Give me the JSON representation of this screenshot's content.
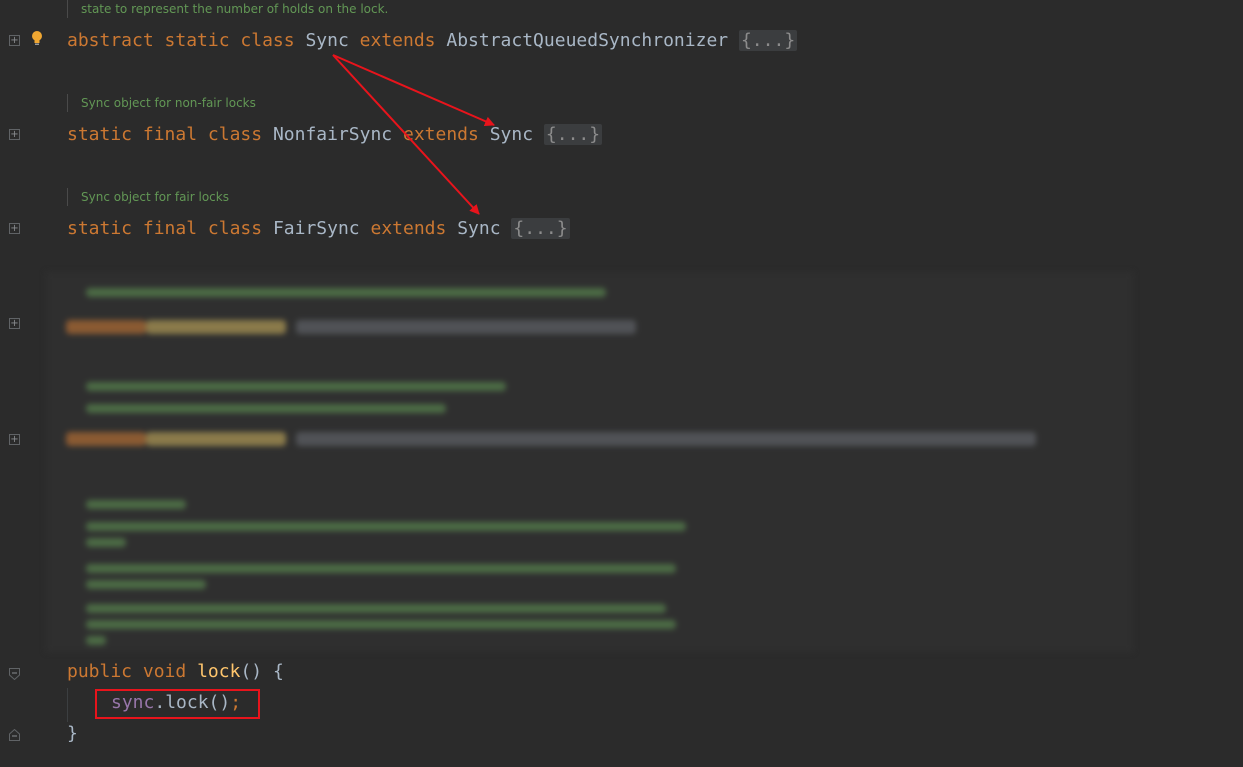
{
  "top_doc": "state to represent the number of holds on the lock.",
  "sync_decl": {
    "kw1": "abstract",
    "kw2": "static",
    "kw3": "class",
    "name": "Sync",
    "extends": "extends",
    "super": "AbstractQueuedSynchronizer",
    "folded": "{...}"
  },
  "nonfair_doc": "Sync object for non-fair locks",
  "nonfair_decl": {
    "kw1": "static",
    "kw2": "final",
    "kw3": "class",
    "name": "NonfairSync",
    "extends": "extends",
    "super": "Sync",
    "folded": "{...}"
  },
  "fair_doc": "Sync object for fair locks",
  "fair_decl": {
    "kw1": "static",
    "kw2": "final",
    "kw3": "class",
    "name": "FairSync",
    "extends": "extends",
    "super": "Sync",
    "folded": "{...}"
  },
  "lock_method": {
    "kw1": "public",
    "kw2": "void",
    "name": "lock",
    "sig_rest": "() {",
    "body_field": "sync",
    "body_call": ".lock()",
    "body_end": ";",
    "close": "}"
  },
  "colors": {
    "background": "#2b2b2b",
    "keyword": "#cc7832",
    "comment": "#629755",
    "method": "#ffc66d",
    "field": "#9876aa",
    "annotation_red": "#e8141c"
  },
  "icons": [
    "fold-plus-icon",
    "fold-minus-icon",
    "intention-bulb-icon"
  ]
}
